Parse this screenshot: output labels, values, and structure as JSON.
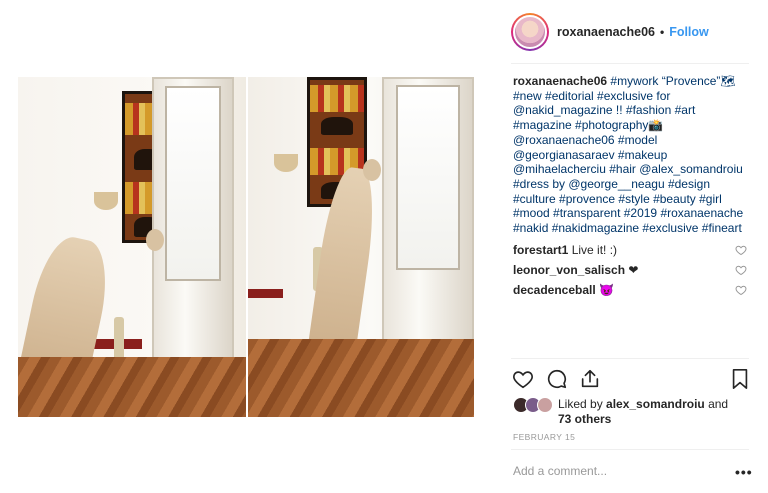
{
  "post": {
    "author": "roxanaenache06",
    "follow_label": "Follow",
    "caption_lines": [
      {
        "prefix_user": "roxanaenache06",
        "text": " #mywork “Provence”🗺"
      },
      {
        "text": "#new #editorial #exclusive for"
      },
      {
        "text": "@nakid_magazine !! #fashion #art"
      },
      {
        "text": "#magazine #photography📸"
      },
      {
        "text": "@roxanaenache06 #model"
      },
      {
        "text": "@georgianasaraev #makeup"
      },
      {
        "text": "@mihaelacherciu #hair @alex_somandroiu"
      },
      {
        "text": "#dress by @george__neagu #design"
      },
      {
        "text": "#culture #provence #style #beauty #girl"
      },
      {
        "text": "#mood #transparent #2019 #roxanaenache"
      },
      {
        "text": "#nakid #nakidmagazine #exclusive #fineart"
      }
    ],
    "comments": [
      {
        "user": "forestart1",
        "text": " Live it! :)"
      },
      {
        "user": "leonor_von_salisch",
        "text": " ❤"
      },
      {
        "user": "decadenceball",
        "text": " 😈"
      }
    ],
    "likes": {
      "prefix": "Liked by ",
      "user": "alex_somandroiu",
      "middle": " and",
      "others": "73 others"
    },
    "date": "FEBRUARY 15",
    "comment_placeholder": "Add a comment...",
    "more_label": "•••"
  },
  "icons": {
    "like": "heart-icon",
    "comment": "comment-icon",
    "share": "share-icon",
    "save": "bookmark-icon"
  },
  "colors": {
    "link": "#3897f0",
    "hashtag": "#003569",
    "muted": "#999999"
  }
}
